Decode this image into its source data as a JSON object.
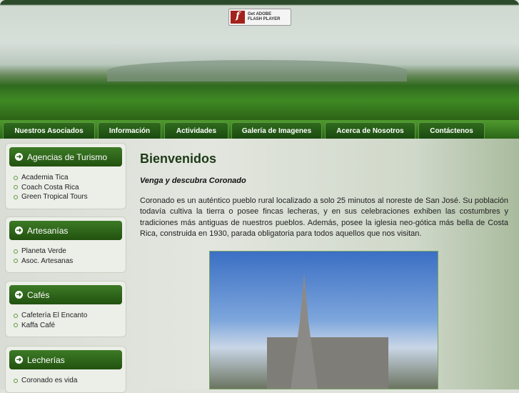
{
  "flash": {
    "line1": "Get ADOBE",
    "line2": "FLASH PLAYER"
  },
  "nav": [
    "Nuestros Asociados",
    "Información",
    "Actividades",
    "Galería de Imagenes",
    "Acerca de Nosotros",
    "Contáctenos"
  ],
  "sidebar": [
    {
      "title": "Agencias de Turismo",
      "items": [
        "Academia Tica",
        "Coach Costa Rica",
        "Green Tropical Tours"
      ]
    },
    {
      "title": "Artesanías",
      "items": [
        "Planeta Verde",
        "Asoc. Artesanas"
      ]
    },
    {
      "title": "Cafés",
      "items": [
        "Cafetería El Encanto",
        "Kaffa Café"
      ]
    },
    {
      "title": "Lecherías",
      "items": [
        "Coronado es vida"
      ]
    }
  ],
  "main": {
    "title": "Bienvenidos",
    "subtitle": "Venga y descubra Coronado",
    "paragraph": "Coronado es un auténtico pueblo rural localizado a solo 25 minutos al noreste de San José. Su población todavía cultiva la tierra o posee fincas lecheras, y en sus celebraciones exhiben las costumbres y tradiciones más antiguas de nuestros pueblos. Además, posee la iglesia neo-gótica más bella de Costa Rica, construida en 1930, parada obligatoria para todos aquellos que nos visitan."
  }
}
